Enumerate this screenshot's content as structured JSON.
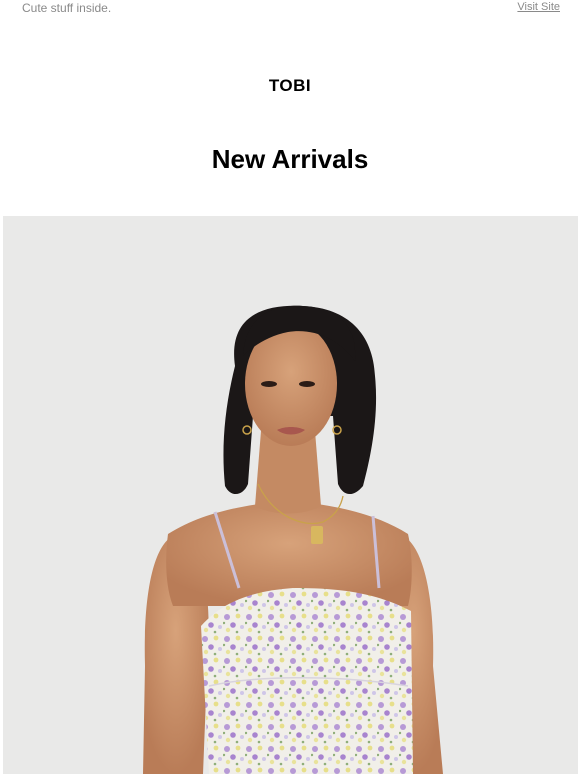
{
  "preheader": {
    "text": "Cute stuff inside.",
    "visit_label": "Visit Site"
  },
  "brand": {
    "logo_text": "TOBI"
  },
  "main": {
    "headline": "New Arrivals",
    "hero_image": "model-floral-dress-photo"
  },
  "colors": {
    "background": "#ffffff",
    "preheader_text": "#8a8a8a",
    "heading_text": "#000000",
    "hero_background": "#e9e9e8"
  }
}
